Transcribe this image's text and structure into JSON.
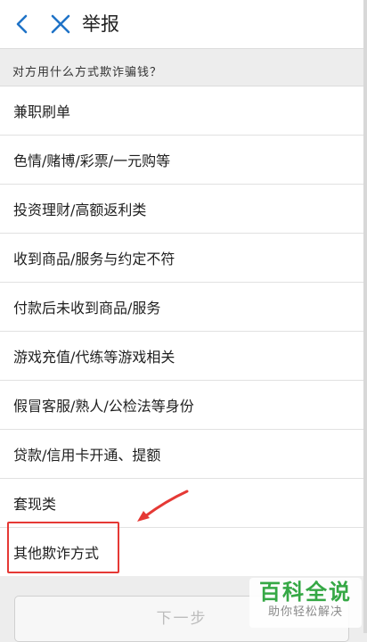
{
  "header": {
    "title": "举报",
    "back_icon": "chevron-left-icon",
    "close_icon": "close-icon",
    "icon_color": "#1f73c7"
  },
  "question": "对方用什么方式欺诈骗钱？",
  "options": [
    {
      "label": "兼职刷单"
    },
    {
      "label": "色情/赌博/彩票/一元购等"
    },
    {
      "label": "投资理财/高额返利类"
    },
    {
      "label": "收到商品/服务与约定不符"
    },
    {
      "label": "付款后未收到商品/服务"
    },
    {
      "label": "游戏充值/代练等游戏相关"
    },
    {
      "label": "假冒客服/熟人/公检法等身份"
    },
    {
      "label": "贷款/信用卡开通、提额"
    },
    {
      "label": "套现类"
    },
    {
      "label": "其他欺诈方式"
    }
  ],
  "annotation": {
    "highlight_color": "#e53935"
  },
  "next_button": {
    "label": "下一步"
  },
  "watermark": {
    "title": "百科全说",
    "subtitle": "助你轻松解决",
    "color": "#35a845"
  }
}
